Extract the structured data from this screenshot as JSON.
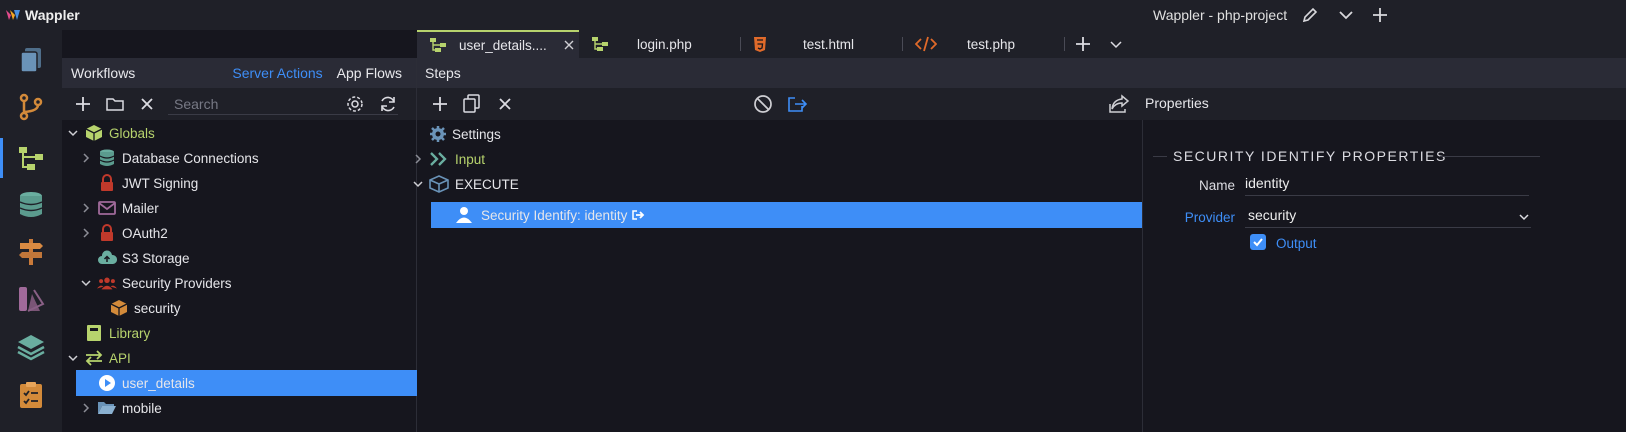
{
  "app": {
    "name": "Wappler",
    "window_title": "Wappler - php-project"
  },
  "rail": {
    "icons": [
      "files-icon",
      "git-icon",
      "workflows-icon",
      "database-icon",
      "routing-icon",
      "design-icon",
      "layers-icon",
      "tasks-icon"
    ]
  },
  "workflows": {
    "title": "Workflows",
    "tab_server_actions": "Server Actions",
    "tab_app_flows": "App Flows",
    "search_placeholder": "Search",
    "tree": [
      {
        "label": "Globals",
        "level": 0,
        "expanded": true,
        "color": "#b7d36d"
      },
      {
        "label": "Database Connections",
        "level": 1,
        "expanded": false
      },
      {
        "label": "JWT Signing",
        "level": 1
      },
      {
        "label": "Mailer",
        "level": 1,
        "expanded": false
      },
      {
        "label": "OAuth2",
        "level": 1,
        "expanded": false
      },
      {
        "label": "S3 Storage",
        "level": 1
      },
      {
        "label": "Security Providers",
        "level": 1,
        "expanded": true
      },
      {
        "label": "security",
        "level": 2
      },
      {
        "label": "Library",
        "level": 0,
        "color": "#b7d36d"
      },
      {
        "label": "API",
        "level": 0,
        "expanded": true,
        "color": "#b7d36d"
      },
      {
        "label": "user_details",
        "level": 1,
        "selected": true
      },
      {
        "label": "mobile",
        "level": 1,
        "expanded": false
      }
    ]
  },
  "tabs": [
    {
      "label": "user_details....",
      "active": true,
      "closable": true
    },
    {
      "label": "login.php"
    },
    {
      "label": "test.html"
    },
    {
      "label": "test.php"
    }
  ],
  "steps": {
    "title": "Steps",
    "properties_label": "Properties",
    "nodes": [
      {
        "label": "Settings"
      },
      {
        "label": "Input",
        "color": "#b7d36d"
      },
      {
        "label": "EXECUTE"
      },
      {
        "label": "Security Identify: identity",
        "selected": true
      }
    ]
  },
  "properties": {
    "section_title": "SECURITY IDENTIFY PROPERTIES",
    "name_label": "Name",
    "name_value": "identity",
    "provider_label": "Provider",
    "provider_value": "security",
    "output_label": "Output",
    "output_checked": true
  },
  "colors": {
    "accent": "#3e8ef7",
    "green": "#b7d36d",
    "panel": "#1f2028",
    "bg": "#16161e"
  }
}
